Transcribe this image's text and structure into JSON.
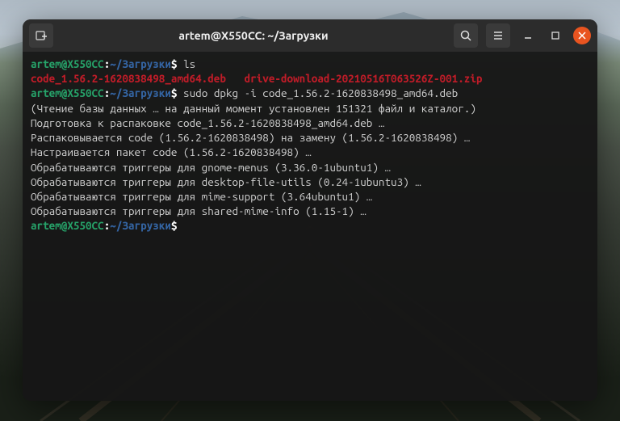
{
  "titlebar": {
    "title": "artem@X550CC: ~/Загрузки"
  },
  "prompt": {
    "user_host": "artem@X550CC",
    "colon": ":",
    "path": "~/Загрузки",
    "dollar": "$"
  },
  "commands": {
    "ls": "ls",
    "sudo_dpkg": "sudo dpkg -i code_1.56.2-1620838498_amd64.deb"
  },
  "ls_output": {
    "file1": "code_1.56.2-1620838498_amd64.deb",
    "file2": "drive-download-20210516T063526Z-001.zip"
  },
  "dpkg_output": [
    "(Чтение базы данных … на данный момент установлен 151321 файл и каталог.)",
    "Подготовка к распаковке code_1.56.2-1620838498_amd64.deb …",
    "Распаковывается code (1.56.2-1620838498) на замену (1.56.2-1620838498) …",
    "Настраивается пакет code (1.56.2-1620838498) …",
    "Обрабатываются триггеры для gnome-menus (3.36.0-1ubuntu1) …",
    "Обрабатываются триггеры для desktop-file-utils (0.24-1ubuntu3) …",
    "Обрабатываются триггеры для mime-support (3.64ubuntu1) …",
    "Обрабатываются триггеры для shared-mime-info (1.15-1) …"
  ]
}
